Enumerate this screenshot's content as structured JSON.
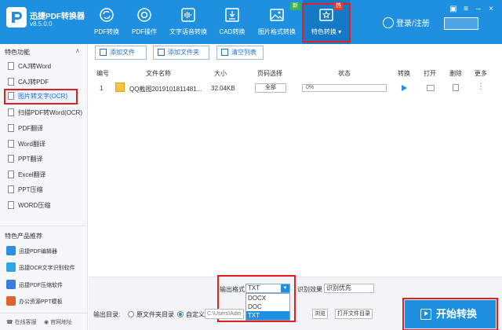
{
  "app": {
    "name": "迅捷PDF转换器",
    "version": "v8.5.0.0"
  },
  "nav": [
    {
      "label": "PDF转换",
      "icon": "refresh-icon"
    },
    {
      "label": "PDF操作",
      "icon": "target-icon"
    },
    {
      "label": "文字语音转换",
      "icon": "waveform-icon"
    },
    {
      "label": "CAD转换",
      "icon": "cad-icon"
    },
    {
      "label": "图片格式转换",
      "icon": "image-icon"
    },
    {
      "label": "特色转换 ▾",
      "icon": "star-icon"
    }
  ],
  "badges": {
    "new": "新",
    "hot": "热"
  },
  "login": "登录/注册",
  "sidebar": {
    "header": "特色功能",
    "items": [
      "CAJ转Word",
      "CAJ转PDF",
      "图片转文字(OCR)",
      "扫描PDF转Word(OCR)",
      "PDF翻译",
      "Word翻译",
      "PPT翻译",
      "Excel翻译",
      "PPT压缩",
      "WORD压缩"
    ],
    "products_header": "特色产品推荐",
    "products": [
      "迅捷PDF编辑器",
      "迅捷OCR文字识别软件",
      "迅捷PDF压缩软件",
      "办公资源PPT模板"
    ],
    "footer": {
      "service": "在线客服",
      "website": "官网地址"
    }
  },
  "toolbar": {
    "add_file": "添加文件",
    "add_folder": "添加文件夹",
    "clear_list": "清空列表"
  },
  "table": {
    "headers": [
      "编号",
      "文件名称",
      "大小",
      "页码选择",
      "状态",
      "转换",
      "打开",
      "删除",
      "更多"
    ],
    "rows": [
      {
        "index": "1",
        "name": "QQ截图2019101811481...",
        "size": "32.04KB",
        "pages": "全部",
        "progress": "0%"
      }
    ]
  },
  "bottom": {
    "format_label": "输出格式",
    "format_value": "TXT",
    "format_options": [
      "DOCX",
      "DOC",
      "TXT"
    ],
    "effect_label": "识别效果",
    "effect_value": "识别优先",
    "output_label": "输出目录:",
    "radio_original": "原文件夹目录",
    "radio_custom": "自定义:",
    "path_value": "C:\\Users\\Adm",
    "browse": "浏览",
    "open_folder": "打开文件目录",
    "start": "开始转换"
  }
}
